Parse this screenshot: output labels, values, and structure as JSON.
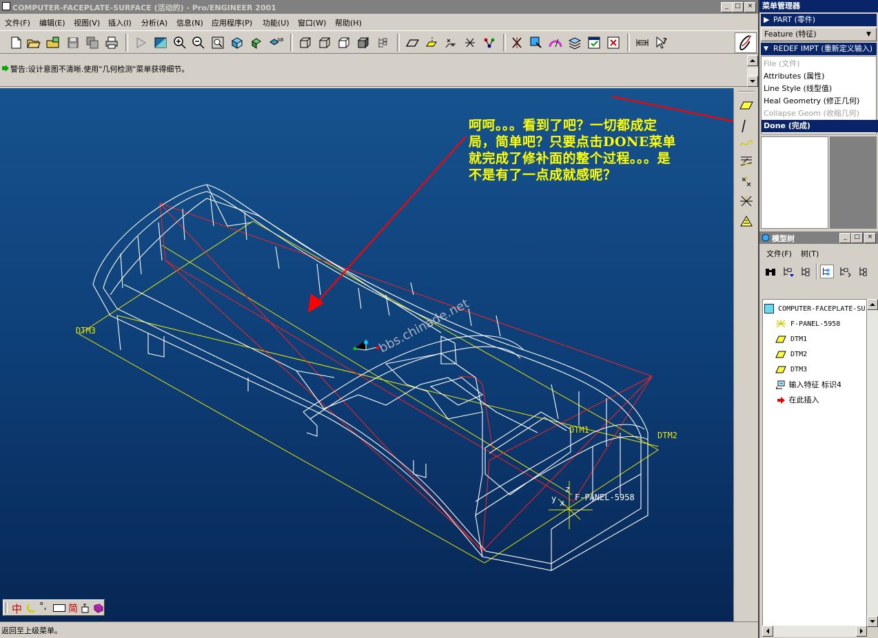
{
  "window": {
    "title": "COMPUTER-FACEPLATE-SURFACE (活动的) - Pro/ENGINEER 2001",
    "min_label": "_",
    "max_label": "□",
    "close_label": "×"
  },
  "menubar": [
    {
      "label": "文件(F)"
    },
    {
      "label": "编辑(E)"
    },
    {
      "label": "视图(V)"
    },
    {
      "label": "插入(I)"
    },
    {
      "label": "分析(A)"
    },
    {
      "label": "信息(N)"
    },
    {
      "label": "应用程序(P)"
    },
    {
      "label": "功能(U)"
    },
    {
      "label": "窗口(W)"
    },
    {
      "label": "帮助(H)"
    }
  ],
  "message": "警告:设计意图不清晰.使用\"几何检测\"菜单获得细节。",
  "status": "返回至上级菜单。",
  "annotation": "呵呵。。。看到了吧？一切都成定局，简单吧？只要点击DONE菜单就完成了修补面的整个过程。。。是不是有了一点成就感呢？",
  "watermark": "bbs.chinade.net",
  "datum_labels": {
    "dtm1": "DTM1",
    "dtm2": "DTM2",
    "dtm3": "DTM3",
    "csys": "F-PANEL-5958",
    "x": "x",
    "y": "y",
    "z": "z"
  },
  "ime_bar": {
    "zh": "中",
    "jian": "简"
  },
  "menu_manager": {
    "title": "菜单管理器",
    "part": "PART (零件)",
    "feature": "Feature (特征)",
    "redef": "REDEF IMPT (重新定义输入)",
    "items": [
      {
        "label": "File (文件)",
        "state": "disabled"
      },
      {
        "label": "Attributes (属性)",
        "state": "normal"
      },
      {
        "label": "Line Style (线型值)",
        "state": "normal"
      },
      {
        "label": "Heal Geometry (修正几何)",
        "state": "normal"
      },
      {
        "label": "Collapse Geom (收缩几何)",
        "state": "disabled"
      },
      {
        "label": "Done (完成)",
        "state": "selected"
      }
    ]
  },
  "model_tree": {
    "title": "模型树",
    "menu": [
      {
        "label": "文件(F)"
      },
      {
        "label": "树(T)"
      }
    ],
    "root": "COMPUTER-FACEPLATE-SU",
    "items": [
      {
        "label": "F-PANEL-5958",
        "icon": "csys-icon"
      },
      {
        "label": "DTM1",
        "icon": "datum-plane-icon"
      },
      {
        "label": "DTM2",
        "icon": "datum-plane-icon"
      },
      {
        "label": "DTM3",
        "icon": "datum-plane-icon"
      },
      {
        "label": "输入特征 标识4",
        "icon": "import-feature-icon"
      },
      {
        "label": "在此插入",
        "icon": "insert-here-icon"
      }
    ]
  },
  "colors": {
    "accent": "#0a246a",
    "annotation": "#ffff00",
    "arrow": "#ff0000",
    "wire": "#ffffff",
    "datum": "#e8e800"
  }
}
